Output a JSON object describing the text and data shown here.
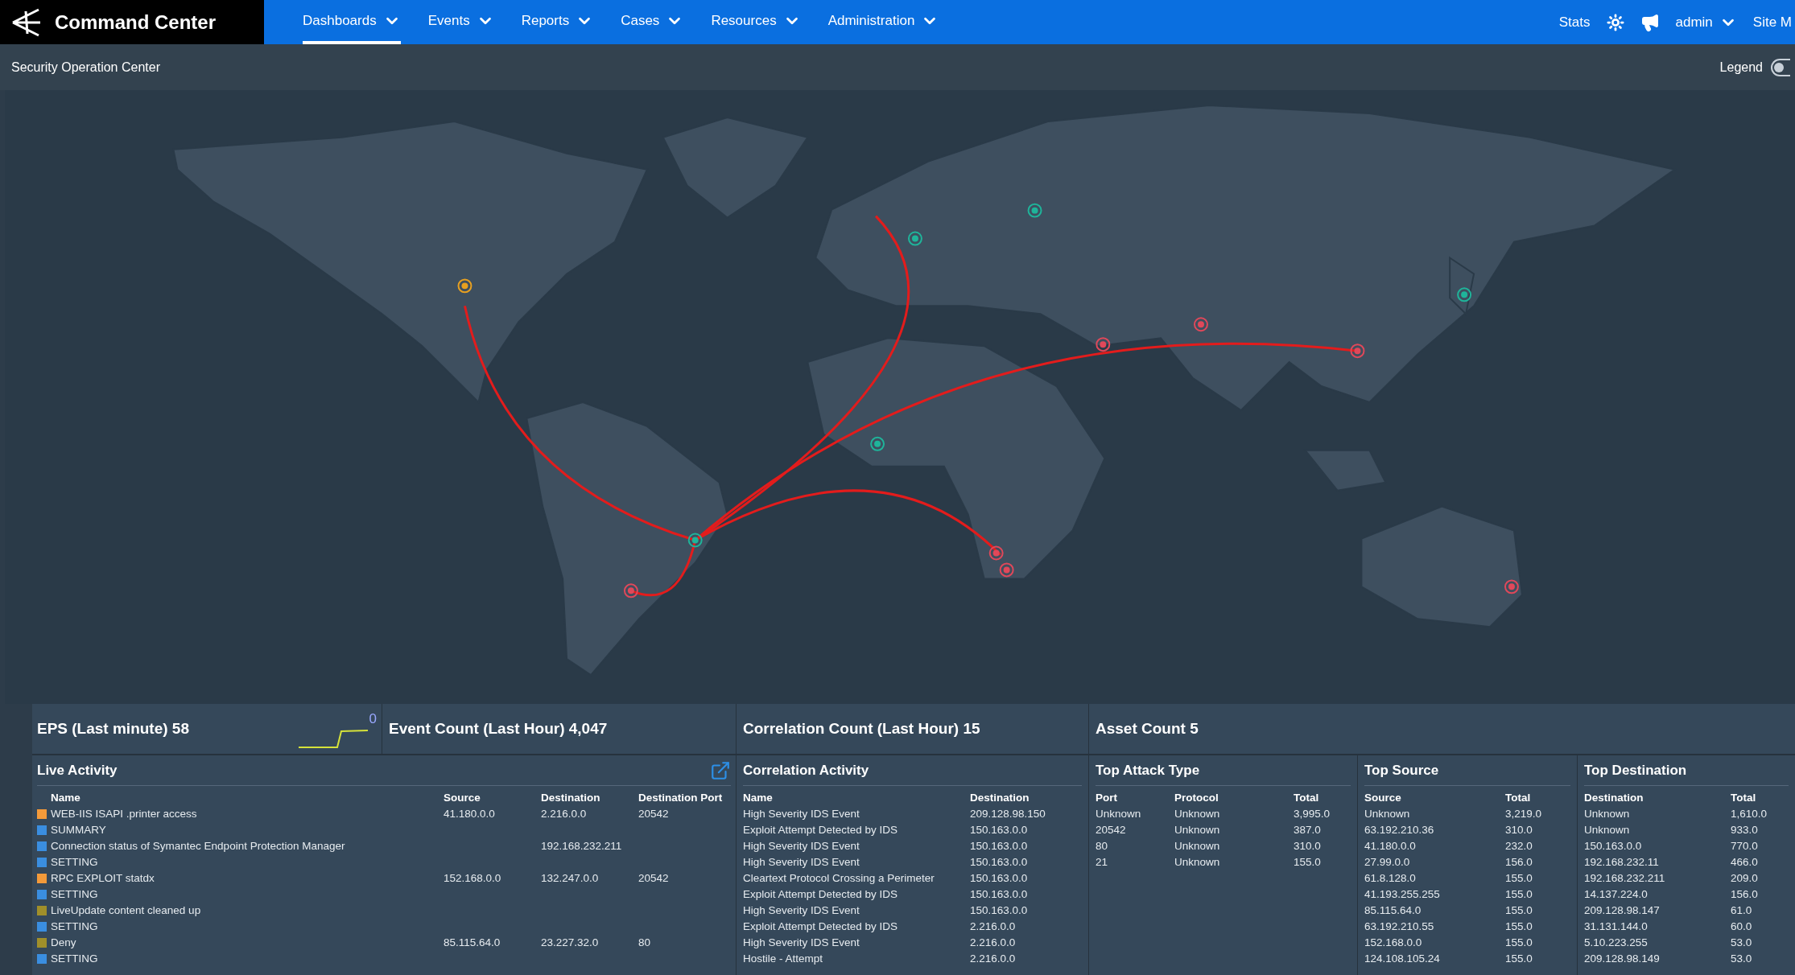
{
  "nav": {
    "logo_text": "Command Center",
    "items": [
      {
        "label": "Dashboards",
        "selected": true
      },
      {
        "label": "Events",
        "selected": false
      },
      {
        "label": "Reports",
        "selected": false
      },
      {
        "label": "Cases",
        "selected": false
      },
      {
        "label": "Resources",
        "selected": false
      },
      {
        "label": "Administration",
        "selected": false
      }
    ],
    "stats": "Stats",
    "user": "admin",
    "site": "Site M"
  },
  "subbar": {
    "title": "Security Operation Center",
    "legend": "Legend",
    "legend_on": false
  },
  "counters": {
    "eps": "EPS (Last minute) 58",
    "eps_spark_label": "0",
    "event_count": "Event Count (Last Hour) 4,047",
    "correlation_count": "Correlation Count (Last Hour) 15",
    "asset_count": "Asset Count 5"
  },
  "live_activity": {
    "title": "Live Activity",
    "columns": [
      "Name",
      "Source",
      "Destination",
      "Destination Port"
    ],
    "rows": [
      {
        "name": "WEB-IIS ISAPI .printer access",
        "source": "41.180.0.0",
        "destination": "2.216.0.0",
        "port": "20542",
        "color": "#f39a3a"
      },
      {
        "name": "SUMMARY",
        "color": "#3a8ee0"
      },
      {
        "name": "Connection status of Symantec Endpoint Protection Manager",
        "destination": "192.168.232.211",
        "color": "#3a8ee0"
      },
      {
        "name": "SETTING",
        "color": "#3a8ee0"
      },
      {
        "name": "RPC EXPLOIT statdx",
        "source": "152.168.0.0",
        "destination": "132.247.0.0",
        "port": "20542",
        "color": "#f39a3a"
      },
      {
        "name": "SETTING",
        "color": "#3a8ee0"
      },
      {
        "name": "LiveUpdate content cleaned up",
        "color": "#a08f2a"
      },
      {
        "name": "SETTING",
        "color": "#3a8ee0"
      },
      {
        "name": "Deny",
        "source": "85.115.64.0",
        "destination": "23.227.32.0",
        "port": "80",
        "color": "#a08f2a"
      },
      {
        "name": "SETTING",
        "color": "#3a8ee0"
      }
    ]
  },
  "correlation_activity": {
    "title": "Correlation Activity",
    "columns": [
      "Name",
      "Destination"
    ],
    "rows": [
      [
        "High Severity IDS Event",
        "209.128.98.150"
      ],
      [
        "Exploit Attempt Detected by IDS",
        "150.163.0.0"
      ],
      [
        "High Severity IDS Event",
        "150.163.0.0"
      ],
      [
        "High Severity IDS Event",
        "150.163.0.0"
      ],
      [
        "Cleartext Protocol Crossing a Perimeter",
        "150.163.0.0"
      ],
      [
        "Exploit Attempt Detected by IDS",
        "150.163.0.0"
      ],
      [
        "High Severity IDS Event",
        "150.163.0.0"
      ],
      [
        "Exploit Attempt Detected by IDS",
        "2.216.0.0"
      ],
      [
        "High Severity IDS Event",
        "2.216.0.0"
      ],
      [
        "Hostile - Attempt",
        "2.216.0.0"
      ]
    ]
  },
  "top_attack_type": {
    "title": "Top Attack Type",
    "columns": [
      "Port",
      "Protocol",
      "Total"
    ],
    "rows": [
      [
        "Unknown",
        "Unknown",
        "3,995.0"
      ],
      [
        "20542",
        "Unknown",
        "387.0"
      ],
      [
        "80",
        "Unknown",
        "310.0"
      ],
      [
        "21",
        "Unknown",
        "155.0"
      ]
    ]
  },
  "top_source": {
    "title": "Top Source",
    "columns": [
      "Source",
      "Total"
    ],
    "rows": [
      [
        "Unknown",
        "3,219.0"
      ],
      [
        "63.192.210.36",
        "310.0"
      ],
      [
        "41.180.0.0",
        "232.0"
      ],
      [
        "27.99.0.0",
        "156.0"
      ],
      [
        "61.8.128.0",
        "155.0"
      ],
      [
        "41.193.255.255",
        "155.0"
      ],
      [
        "85.115.64.0",
        "155.0"
      ],
      [
        "63.192.210.55",
        "155.0"
      ],
      [
        "152.168.0.0",
        "155.0"
      ],
      [
        "124.108.105.24",
        "155.0"
      ]
    ]
  },
  "top_destination": {
    "title": "Top Destination",
    "columns": [
      "Destination",
      "Total"
    ],
    "rows": [
      [
        "Unknown",
        "1,610.0"
      ],
      [
        "Unknown",
        "933.0"
      ],
      [
        "150.163.0.0",
        "770.0"
      ],
      [
        "192.168.232.11",
        "466.0"
      ],
      [
        "192.168.232.211",
        "209.0"
      ],
      [
        "14.137.224.0",
        "156.0"
      ],
      [
        "209.128.98.147",
        "61.0"
      ],
      [
        "31.131.144.0",
        "60.0"
      ],
      [
        "5.10.223.255",
        "53.0"
      ],
      [
        "209.128.98.149",
        "53.0"
      ]
    ]
  }
}
